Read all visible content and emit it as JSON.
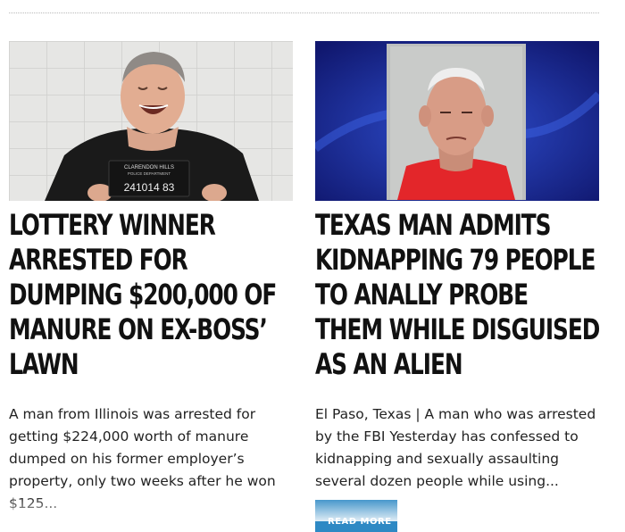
{
  "articles": [
    {
      "headline": "LOTTERY WINNER ARRESTED FOR DUMPING $200,000 OF MANURE ON EX-BOSS’ LAWN",
      "excerpt": "A man from Illinois was arrested for getting $224,000 worth of manure dumped on his former employer’s property, only two weeks after he won $125...",
      "image": {
        "placard_line1": "CLARENDON HILLS",
        "placard_line2": "POLICE DEPARTMENT",
        "placard_number": "241014 83"
      }
    },
    {
      "headline": "TEXAS MAN ADMITS KIDNAPPING 79 PEOPLE TO ANALLY PROBE THEM WHILE DISGUISED AS AN ALIEN",
      "excerpt": "El Paso, Texas | A man who was arrested by the FBI Yesterday has confessed to kidnapping and sexually assaulting several dozen people while using...",
      "read_more": "READ MORE"
    }
  ],
  "colors": {
    "read_more_bg": "#2e89c4",
    "right_image_bg": "#1a2a8c",
    "right_shirt": "#e3262a"
  }
}
